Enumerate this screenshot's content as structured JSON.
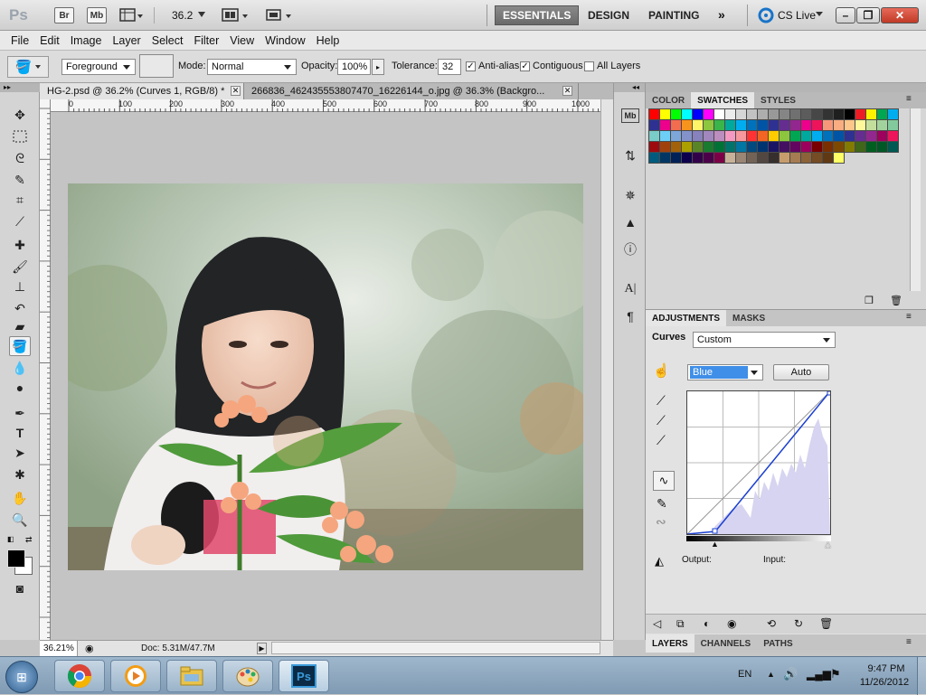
{
  "appbar": {
    "logo": "Ps",
    "bridge": "Br",
    "minibridge": "Mb",
    "zoom": "36.2",
    "workspaces": [
      "ESSENTIALS",
      "DESIGN",
      "PAINTING"
    ],
    "cslive": "CS Live"
  },
  "menu": [
    "File",
    "Edit",
    "Image",
    "Layer",
    "Select",
    "Filter",
    "View",
    "Window",
    "Help"
  ],
  "options": {
    "fill_source": "Foreground",
    "mode_label": "Mode:",
    "mode_value": "Normal",
    "opacity_label": "Opacity:",
    "opacity_value": "100%",
    "tolerance_label": "Tolerance:",
    "tolerance_value": "32",
    "antialias": "Anti-alias",
    "contiguous": "Contiguous",
    "all_layers": "All Layers"
  },
  "tabs": [
    "HG-2.psd @ 36.2% (Curves 1, RGB/8) *",
    "266836_462435553807470_16226144_o.jpg @ 36.3% (Backgro..."
  ],
  "ruler_ticks": [
    "0",
    "100",
    "200",
    "300",
    "400",
    "500",
    "600",
    "700",
    "800",
    "900",
    "1000"
  ],
  "status": {
    "zoom": "36.21%",
    "doc": "Doc: 5.31M/47.7M"
  },
  "panels": {
    "top_tabs": [
      "COLOR",
      "SWATCHES",
      "STYLES"
    ],
    "adj_tabs": [
      "ADJUSTMENTS",
      "MASKS"
    ],
    "bottom_tabs": [
      "LAYERS",
      "CHANNELS",
      "PATHS"
    ]
  },
  "swatch_colors": [
    "#ff0000",
    "#ffff00",
    "#00ff00",
    "#00ffff",
    "#0000ff",
    "#ff00ff",
    "#ffffff",
    "#ebebeb",
    "#d6d6d6",
    "#c2c2c2",
    "#adadad",
    "#999999",
    "#858585",
    "#707070",
    "#5c5c5c",
    "#474747",
    "#333333",
    "#1f1f1f",
    "#000000",
    "#ed1c24",
    "#fff200",
    "#00a651",
    "#00aeef",
    "#2e3192",
    "#ec008c",
    "#f26c4f",
    "#f7941d",
    "#fff568",
    "#8dc63f",
    "#39b54a",
    "#00a99d",
    "#00aef0",
    "#0072bc",
    "#0054a6",
    "#2e3192",
    "#662d91",
    "#92278f",
    "#ec008c",
    "#ed145b",
    "#f7977a",
    "#f9ad81",
    "#fdc68a",
    "#fff799",
    "#c4df9b",
    "#a3d39c",
    "#82ca9d",
    "#7accc8",
    "#6dcff6",
    "#7da7d9",
    "#8393ca",
    "#8781bd",
    "#a187be",
    "#bc8dbf",
    "#f49ac2",
    "#f6989d",
    "#ff3333",
    "#f26522",
    "#ffcc00",
    "#8cc63f",
    "#00a651",
    "#00a99d",
    "#00aeef",
    "#0072bc",
    "#0054a6",
    "#2e3192",
    "#662d91",
    "#92278f",
    "#9e005d",
    "#ed145b",
    "#9e0b0f",
    "#a0410d",
    "#a36209",
    "#aba000",
    "#598527",
    "#197b30",
    "#007236",
    "#00746b",
    "#0076a3",
    "#004a80",
    "#003471",
    "#1b1464",
    "#440e62",
    "#630460",
    "#9e005d",
    "#790000",
    "#7b2e00",
    "#7d4900",
    "#827b00",
    "#406618",
    "#005e20",
    "#005826",
    "#005952",
    "#005b7f",
    "#003663",
    "#002157",
    "#0d004c",
    "#32004b",
    "#4b0049",
    "#7b0046",
    "#c7b299",
    "#998675",
    "#736357",
    "#534741",
    "#362f2d",
    "#c69c6d",
    "#a67c52",
    "#8c6239",
    "#754c24",
    "#603913",
    "#ffff66"
  ],
  "adjustments": {
    "title": "Curves",
    "preset": "Custom",
    "channel": "Blue",
    "auto": "Auto",
    "output": "Output:",
    "input": "Input:"
  },
  "taskbar": {
    "lang": "EN",
    "time": "9:47 PM",
    "date": "11/26/2012",
    "ps_label": "Ps"
  }
}
